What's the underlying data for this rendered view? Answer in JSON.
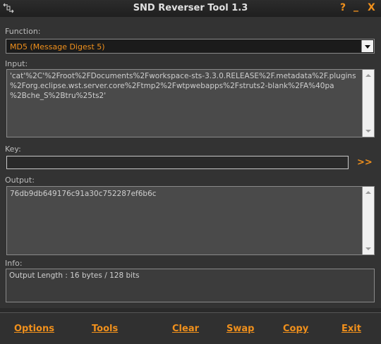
{
  "window": {
    "title": "SND Reverser Tool 1.3",
    "help_label": "?",
    "minimize_label": "_",
    "close_label": "X"
  },
  "function": {
    "label": "Function:",
    "selected": "MD5 (Message Digest 5)"
  },
  "input": {
    "label": "Input:",
    "value": "'cat'%2C'%2Froot%2FDocuments%2Fworkspace-sts-3.3.0.RELEASE%2F.metadata%2F.plugins\n%2Forg.eclipse.wst.server.core%2Ftmp2%2Fwtpwebapps%2Fstruts2-blank%2FA%40pa\n%2Bche_S%2Btru%25ts2'"
  },
  "key": {
    "label": "Key:",
    "value": "",
    "go_label": ">>"
  },
  "output": {
    "label": "Output:",
    "value": "76db9db649176c91a30c752287ef6b6c"
  },
  "info": {
    "label": "Info:",
    "value": "Output Length : 16 bytes / 128 bits"
  },
  "menu": {
    "options": "Options",
    "tools": "Tools",
    "clear": "Clear",
    "swap": "Swap",
    "copy": "Copy",
    "exit": "Exit"
  },
  "colors": {
    "accent": "#f0901c",
    "background": "#333333",
    "titlebar": "#1f1f1f"
  }
}
